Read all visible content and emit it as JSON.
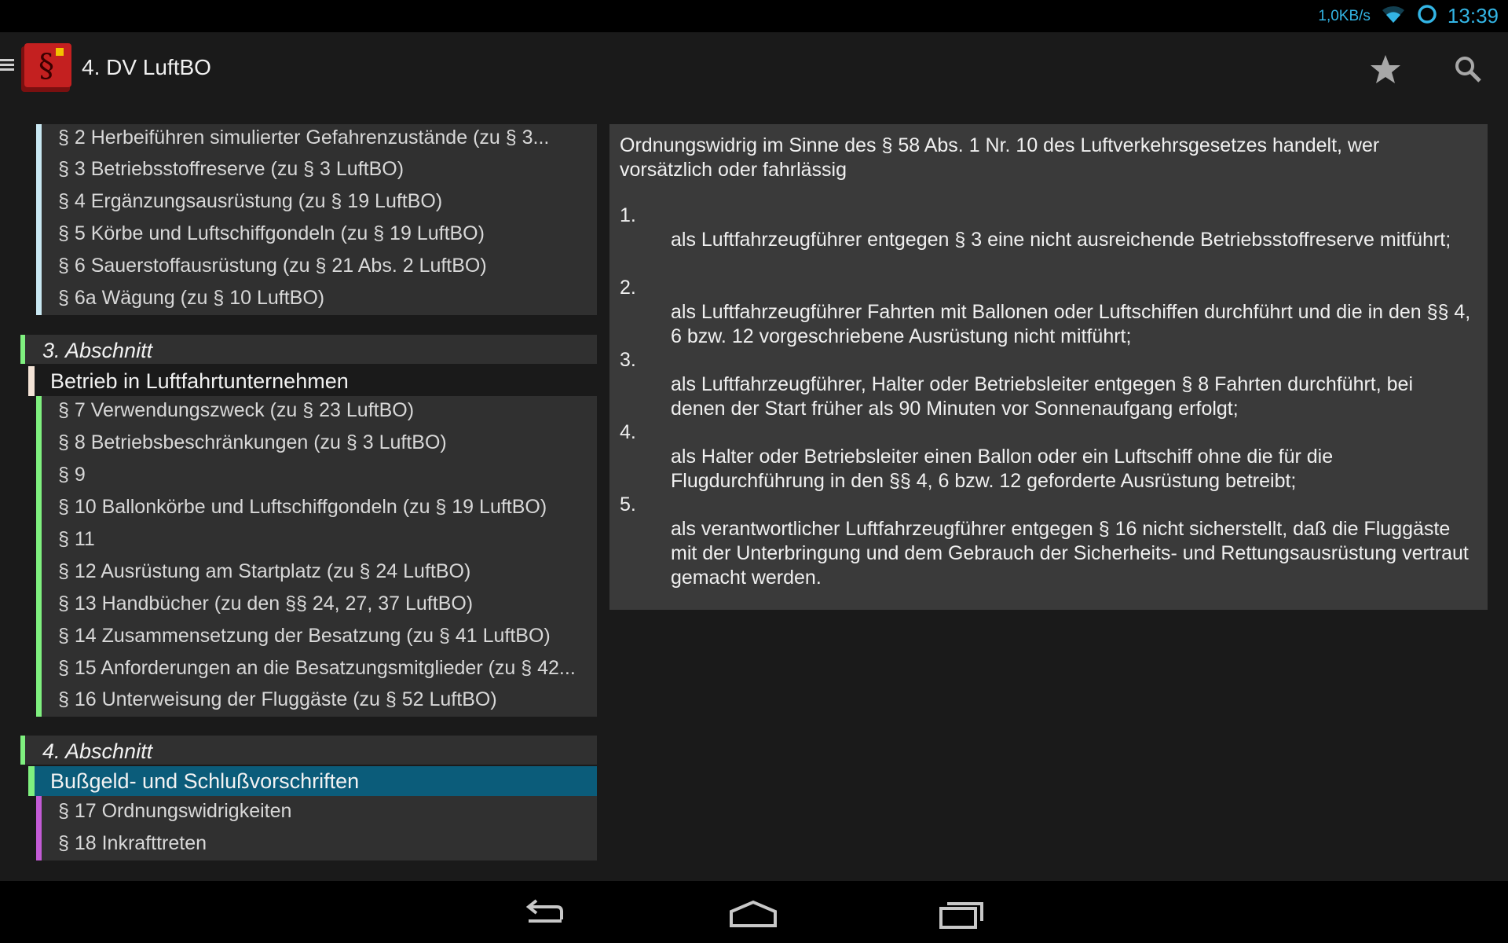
{
  "status_bar": {
    "net_speed": "1,0KB/s",
    "time": "13:39",
    "icons": [
      "wifi-icon",
      "sync-ring-icon"
    ]
  },
  "action_bar": {
    "title": "4. DV LuftBO",
    "icons": [
      "menu-icon",
      "app-logo-icon",
      "star-icon",
      "search-icon"
    ]
  },
  "toc": {
    "group2_items": [
      "§ 2 Herbeiführen simulierter Gefahrenzustände (zu § 3...",
      "§ 3 Betriebsstoffreserve (zu § 3 LuftBO)",
      "§ 4 Ergänzungsausrüstung (zu § 19 LuftBO)",
      "§ 5 Körbe und Luftschiffgondeln (zu § 19 LuftBO)",
      "§ 6 Sauerstoffausrüstung (zu § 21 Abs. 2 LuftBO)",
      "§ 6a Wägung (zu § 10 LuftBO)"
    ],
    "section3": {
      "label": "3. Abschnitt",
      "title": "Betrieb in Luftfahrtunternehmen",
      "items": [
        "§ 7 Verwendungszweck (zu § 23 LuftBO)",
        "§ 8 Betriebsbeschränkungen (zu § 3 LuftBO)",
        "§ 9",
        "§ 10 Ballonkörbe und Luftschiffgondeln (zu § 19 LuftBO)",
        "§ 11",
        "§ 12 Ausrüstung am Startplatz (zu § 24 LuftBO)",
        "§ 13 Handbücher (zu den §§ 24, 27, 37 LuftBO)",
        "§ 14 Zusammensetzung der Besatzung (zu § 41 LuftBO)",
        "§ 15 Anforderungen an die Besatzungsmitglieder (zu § 42...",
        "§ 16 Unterweisung der Fluggäste (zu § 52 LuftBO)"
      ]
    },
    "section4": {
      "label": "4. Abschnitt",
      "title": "Bußgeld- und Schlußvorschriften",
      "items": [
        "§ 17 Ordnungswidrigkeiten",
        "§ 18 Inkrafttreten"
      ]
    }
  },
  "content": {
    "intro": "Ordnungswidrig im Sinne des § 58 Abs. 1 Nr. 10 des Luftverkehrsgesetzes handelt, wer vorsätzlich oder fahrlässig",
    "clauses": [
      {
        "num": "1.",
        "text": "als Luftfahrzeugführer entgegen § 3 eine nicht ausreichende Betriebsstoffreserve mitführt;"
      },
      {
        "num": "2.",
        "text": "als Luftfahrzeugführer Fahrten mit Ballonen oder Luftschiffen durchführt und die in den §§ 4, 6 bzw. 12 vorgeschriebene Ausrüstung nicht mitführt;"
      },
      {
        "num": "3.",
        "text": "als Luftfahrzeugführer, Halter oder Betriebsleiter entgegen § 8 Fahrten durchführt, bei denen der Start früher als 90 Minuten vor Sonnenaufgang erfolgt;"
      },
      {
        "num": "4.",
        "text": "als Halter oder Betriebsleiter einen Ballon oder ein Luftschiff ohne die für die Flugdurchführung in den §§ 4, 6 bzw. 12 geforderte Ausrüstung betreibt;"
      },
      {
        "num": "5.",
        "text": "als verantwortlicher Luftfahrzeugführer entgegen § 16 nicht sicherstellt, daß die Fluggäste mit der Unterbringung und dem Gebrauch der Sicherheits- und Rettungsausrüstung vertraut gemacht werden."
      }
    ]
  },
  "nav_bar": {
    "icons": [
      "back-icon",
      "home-icon",
      "recents-icon"
    ]
  },
  "colors": {
    "accent": "#33b5e5",
    "selected_row": "#0b5c7a",
    "section_bar": "#7ff07f",
    "group2_bar": "#c9e8f2",
    "section3_title_bar": "#f3e3d6",
    "section4_items_bar": "#c35bd6"
  }
}
